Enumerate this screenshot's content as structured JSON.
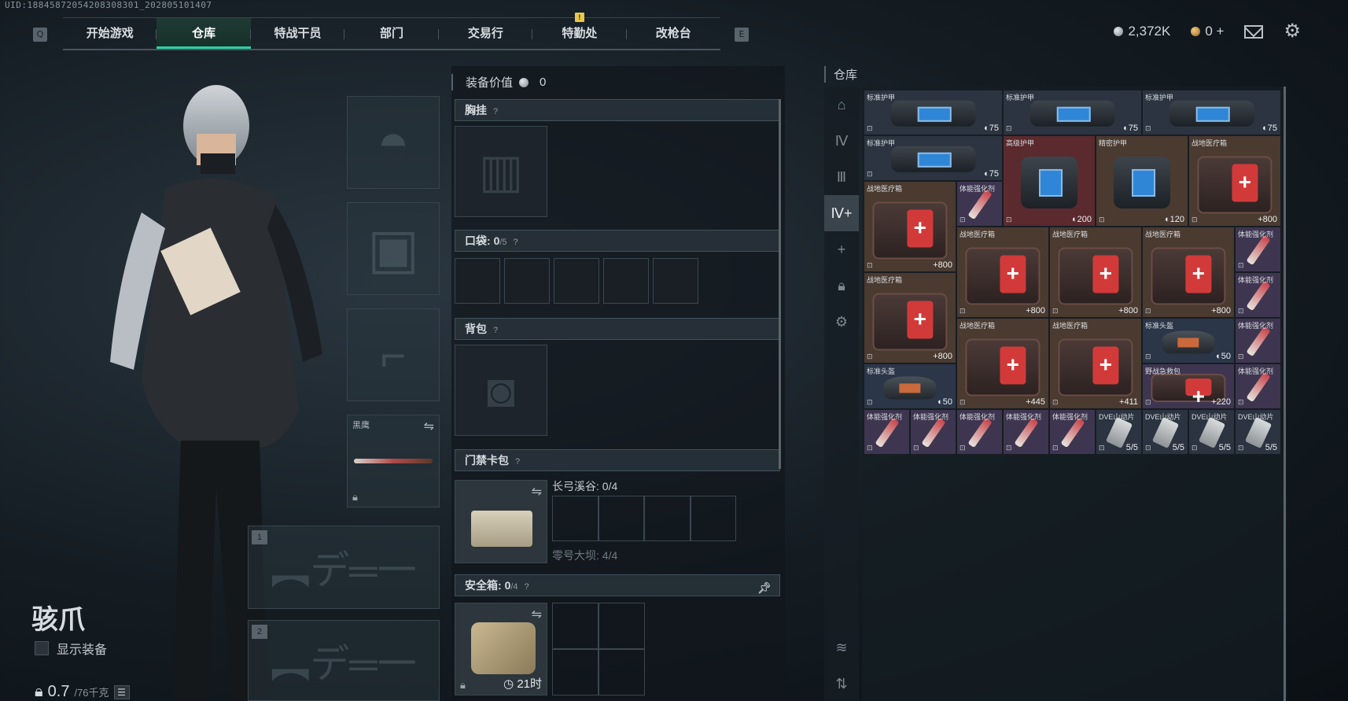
{
  "uid": "UID:18845872054208308301_202805101407",
  "nav": {
    "left_key": "Q",
    "right_key": "E",
    "tabs": [
      {
        "label": "开始游戏",
        "active": false
      },
      {
        "label": "仓库",
        "active": true
      },
      {
        "label": "特战干员",
        "active": false
      },
      {
        "label": "部门",
        "active": false
      },
      {
        "label": "交易行",
        "active": false
      },
      {
        "label": "特勤处",
        "active": false,
        "badge": "!"
      },
      {
        "label": "改枪台",
        "active": false
      }
    ]
  },
  "currency": {
    "silver": "2,372K",
    "gold": "0",
    "gold_add": "+"
  },
  "character": {
    "name": "骇爪",
    "show_equipment": "显示装备",
    "weight": "0.7",
    "weight_max": "/76千克"
  },
  "slots": {
    "knife_name": "黑鹰",
    "weapon1": "1",
    "weapon2": "2"
  },
  "loadout": {
    "equip_value_label": "装备价值",
    "equip_value": "0",
    "chest_rig": "胸挂",
    "pockets": "口袋:",
    "pockets_count": "0",
    "pockets_max": "/5",
    "backpack": "背包",
    "keycard": "门禁卡包",
    "key_valley": "长弓溪谷: 0/4",
    "key_dam": "零号大坝: 4/4",
    "safebox": "安全箱:",
    "safebox_count": "0",
    "safebox_max": "/4",
    "safebox_timer": "21时",
    "help": "?"
  },
  "warehouse": {
    "title": "仓库",
    "items": [
      {
        "name": "标准护甲",
        "value": "◐75",
        "kind": "armor",
        "bg": "bg-dark"
      },
      {
        "name": "标准护甲",
        "value": "◐75",
        "kind": "armor",
        "bg": "bg-dark"
      },
      {
        "name": "标准护甲",
        "value": "◐75",
        "kind": "armor",
        "bg": "bg-dark"
      },
      {
        "name": "标准护甲",
        "value": "◐75",
        "kind": "armor",
        "bg": "bg-dark"
      },
      {
        "name": "高级护甲",
        "value": "◐200",
        "kind": "armor",
        "bg": "bg-red"
      },
      {
        "name": "精密护甲",
        "value": "◐120",
        "kind": "armor",
        "bg": "bg-brown"
      },
      {
        "name": "战地医疗箱",
        "value": "+800",
        "kind": "medkit",
        "bg": "bg-brown"
      },
      {
        "name": "战地医疗箱",
        "value": "+800",
        "kind": "medkit",
        "bg": "bg-brown"
      },
      {
        "name": "体能强化剂",
        "value": "",
        "kind": "syringe",
        "bg": "bg-purple"
      },
      {
        "name": "战地医疗箱",
        "value": "+800",
        "kind": "medkit",
        "bg": "bg-brown"
      },
      {
        "name": "战地医疗箱",
        "value": "+800",
        "kind": "medkit",
        "bg": "bg-brown"
      },
      {
        "name": "战地医疗箱",
        "value": "+800",
        "kind": "medkit",
        "bg": "bg-brown"
      },
      {
        "name": "体能强化剂",
        "value": "",
        "kind": "syringe",
        "bg": "bg-purple"
      },
      {
        "name": "战地医疗箱",
        "value": "+800",
        "kind": "medkit",
        "bg": "bg-brown"
      },
      {
        "name": "体能强化剂",
        "value": "",
        "kind": "syringe",
        "bg": "bg-purple"
      },
      {
        "name": "战地医疗箱",
        "value": "+445",
        "kind": "medkit",
        "bg": "bg-brown"
      },
      {
        "name": "战地医疗箱",
        "value": "+411",
        "kind": "medkit",
        "bg": "bg-brown"
      },
      {
        "name": "标准头盔",
        "value": "◐50",
        "kind": "helmet",
        "bg": "bg-blue"
      },
      {
        "name": "体能强化剂",
        "value": "",
        "kind": "syringe",
        "bg": "bg-purple"
      },
      {
        "name": "标准头盔",
        "value": "◐50",
        "kind": "helmet",
        "bg": "bg-blue"
      },
      {
        "name": "野战急救包",
        "value": "+220",
        "kind": "medkit",
        "bg": "bg-purple"
      },
      {
        "name": "体能强化剂",
        "value": "",
        "kind": "syringe",
        "bg": "bg-purple"
      },
      {
        "name": "体能强化剂",
        "value": "",
        "kind": "syringe",
        "bg": "bg-purple"
      },
      {
        "name": "体能强化剂",
        "value": "",
        "kind": "syringe",
        "bg": "bg-purple"
      },
      {
        "name": "体能强化剂",
        "value": "",
        "kind": "syringe",
        "bg": "bg-purple"
      },
      {
        "name": "体能强化剂",
        "value": "",
        "kind": "syringe",
        "bg": "bg-purple"
      },
      {
        "name": "体能强化剂",
        "value": "",
        "kind": "syringe",
        "bg": "bg-purple"
      },
      {
        "name": "DVE山动片",
        "value": "5/5",
        "kind": "battery",
        "bg": "bg-dark"
      },
      {
        "name": "DVE山动片",
        "value": "5/5",
        "kind": "battery",
        "bg": "bg-dark"
      },
      {
        "name": "DVE山动片",
        "value": "5/5",
        "kind": "battery",
        "bg": "bg-dark"
      },
      {
        "name": "DVE山动片",
        "value": "5/5",
        "kind": "battery",
        "bg": "bg-dark"
      }
    ]
  }
}
